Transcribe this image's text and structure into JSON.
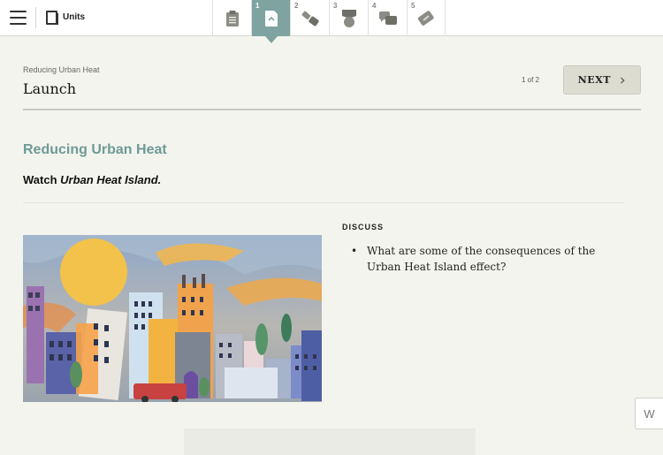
{
  "topbar": {
    "units_label": "Units",
    "steps": [
      {
        "num": "",
        "icon": "clipboard-icon"
      },
      {
        "num": "1",
        "icon": "launch-page-icon",
        "active": true
      },
      {
        "num": "2",
        "icon": "tools-icon"
      },
      {
        "num": "3",
        "icon": "award-icon"
      },
      {
        "num": "4",
        "icon": "discussion-bubbles-icon"
      },
      {
        "num": "5",
        "icon": "ticket-icon"
      }
    ]
  },
  "header": {
    "breadcrumb": "Reducing Urban Heat",
    "title": "Launch",
    "counter": "1 of 2",
    "next_label": "NEXT"
  },
  "main": {
    "section_title": "Reducing Urban Heat",
    "watch_prefix": "Watch ",
    "watch_title": "Urban Heat Island.",
    "discuss_label": "DISCUSS",
    "discuss_items": [
      "What are some of the consequences of the Urban Heat Island effect?"
    ]
  },
  "widget": {
    "label": "W"
  },
  "colors": {
    "accent": "#7ea3a0",
    "section_title": "#6e9a96",
    "background": "#f4f4ee"
  }
}
